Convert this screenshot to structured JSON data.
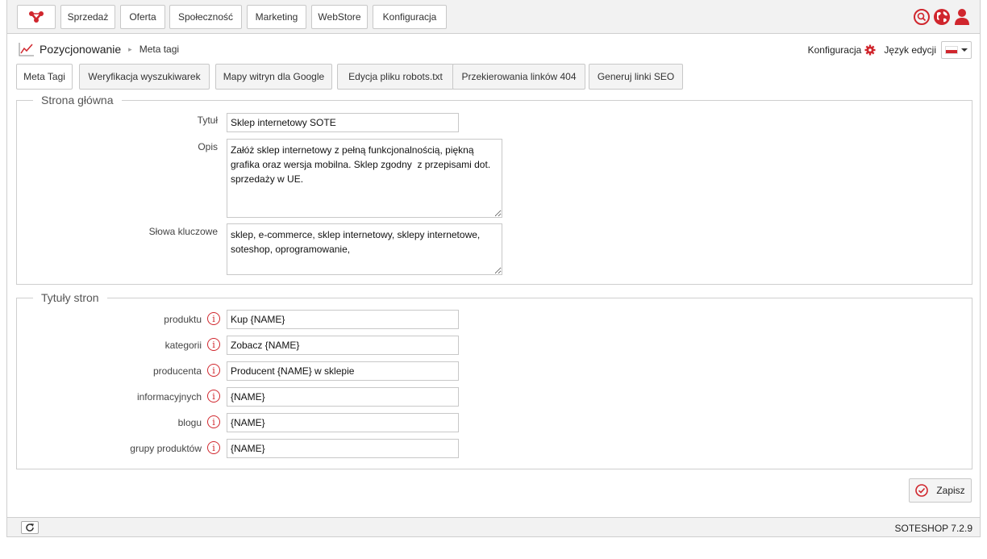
{
  "colors": {
    "accent": "#d0262d",
    "toolbar_bg": "#f2f2f2",
    "border": "#cfcfcf"
  },
  "nav": {
    "logo_icon": "soteshop-logo-icon",
    "items": [
      {
        "label": "Sprzedaż"
      },
      {
        "label": "Oferta"
      },
      {
        "label": "Społeczność"
      },
      {
        "label": "Marketing"
      },
      {
        "label": "WebStore"
      },
      {
        "label": "Konfiguracja"
      }
    ],
    "right_icons": [
      "search-icon",
      "globe-icon",
      "user-icon"
    ]
  },
  "breadcrumb": {
    "icon": "chart-line-icon",
    "title": "Pozycjonowanie",
    "separator": "▸",
    "current": "Meta tagi"
  },
  "toolbar": {
    "config_label": "Konfiguracja",
    "config_icon": "gear-icon",
    "lang_label": "Język edycji",
    "lang_flag": "poland-flag-icon"
  },
  "tabs": [
    {
      "label": "Meta Tagi",
      "active": true
    },
    {
      "label": "Weryfikacja wyszukiwarek"
    },
    {
      "label": "Mapy witryn dla Google"
    },
    {
      "label": "Edycja pliku robots.txt"
    },
    {
      "label": "Przekierowania linków 404"
    },
    {
      "label": "Generuj linki SEO"
    }
  ],
  "homepage": {
    "legend": "Strona główna",
    "title_label": "Tytuł",
    "title_value": "Sklep internetowy SOTE",
    "desc_label": "Opis",
    "desc_value": "Załóż sklep internetowy z pełną funkcjonalnością, piękną grafika oraz wersja mobilna. Sklep zgodny  z przepisami dot. sprzedaży w UE.",
    "keywords_label": "Słowa kluczowe",
    "keywords_value": "sklep, e-commerce, sklep internetowy, sklepy internetowe, soteshop, oprogramowanie,"
  },
  "page_titles": {
    "legend": "Tytuły stron",
    "info_glyph": "i",
    "rows": [
      {
        "label": "produktu",
        "value": "Kup {NAME}"
      },
      {
        "label": "kategorii",
        "value": "Zobacz {NAME}"
      },
      {
        "label": "producenta",
        "value": "Producent {NAME} w sklepie"
      },
      {
        "label": "informacyjnych",
        "value": "{NAME}"
      },
      {
        "label": "blogu",
        "value": "{NAME}"
      },
      {
        "label": "grupy produktów",
        "value": "{NAME}"
      }
    ]
  },
  "save": {
    "label": "Zapisz",
    "icon": "check-circle-icon"
  },
  "footer": {
    "refresh_icon": "refresh-icon",
    "version": "SOTESHOP 7.2.9"
  }
}
